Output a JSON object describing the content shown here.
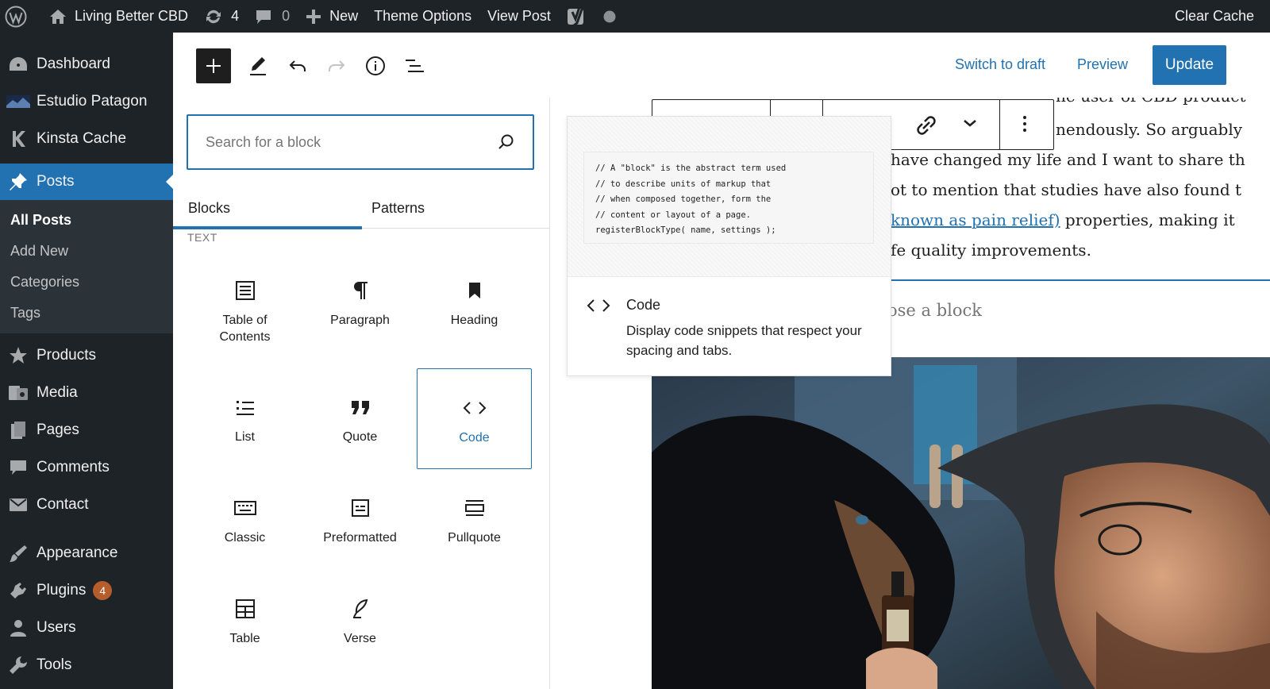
{
  "admin_bar": {
    "site_name": "Living Better CBD",
    "updates_count": "4",
    "comments_count": "0",
    "new_label": "New",
    "theme_options_label": "Theme Options",
    "view_post_label": "View Post",
    "clear_cache_label": "Clear Cache"
  },
  "sidebar": {
    "top_items": [
      {
        "label": "Dashboard",
        "icon": "dashboard-icon"
      },
      {
        "label": "Estudio Patagon",
        "icon": "estudio-logo-icon"
      },
      {
        "label": "Kinsta Cache",
        "icon": "kinsta-icon"
      }
    ],
    "posts_label": "Posts",
    "posts_submenu": [
      "All Posts",
      "Add New",
      "Categories",
      "Tags"
    ],
    "items": [
      {
        "label": "Products",
        "icon": "star-icon"
      },
      {
        "label": "Media",
        "icon": "media-icon"
      },
      {
        "label": "Pages",
        "icon": "pages-icon"
      },
      {
        "label": "Comments",
        "icon": "comment-icon"
      },
      {
        "label": "Contact",
        "icon": "mail-icon"
      },
      {
        "label": "Appearance",
        "icon": "brush-icon"
      },
      {
        "label": "Plugins",
        "icon": "plugin-icon",
        "badge": "4"
      },
      {
        "label": "Users",
        "icon": "user-icon"
      },
      {
        "label": "Tools",
        "icon": "wrench-icon"
      }
    ]
  },
  "header": {
    "switch_to_draft": "Switch to draft",
    "preview": "Preview",
    "update": "Update"
  },
  "inserter": {
    "search_placeholder": "Search for a block",
    "tabs": [
      "Blocks",
      "Patterns"
    ],
    "active_tab": "Blocks",
    "category": "TEXT",
    "blocks": [
      {
        "label": "Table of Contents",
        "icon": "table-of-contents-icon"
      },
      {
        "label": "Paragraph",
        "icon": "paragraph-icon"
      },
      {
        "label": "Heading",
        "icon": "heading-bookmark-icon"
      },
      {
        "label": "List",
        "icon": "list-icon"
      },
      {
        "label": "Quote",
        "icon": "quote-icon"
      },
      {
        "label": "Code",
        "icon": "code-icon",
        "selected": true
      },
      {
        "label": "Classic",
        "icon": "keyboard-icon"
      },
      {
        "label": "Preformatted",
        "icon": "preformatted-icon"
      },
      {
        "label": "Pullquote",
        "icon": "pullquote-icon"
      },
      {
        "label": "Table",
        "icon": "table-icon"
      },
      {
        "label": "Verse",
        "icon": "feather-icon"
      }
    ]
  },
  "preview": {
    "code_lines": [
      "// A \"block\" is the abstract term used",
      "// to describe units of markup that",
      "// when composed together, form the",
      "// content or layout of a page.",
      "registerBlockType( name, settings );"
    ],
    "title": "Code",
    "description": "Display code snippets that respect your spacing and tabs."
  },
  "content": {
    "lines": [
      "ne user of CBD product",
      "nendously. So arguably",
      "have changed my life and I want to share th",
      "ot to mention that studies have also found t",
      "fe quality improvements."
    ],
    "link_text": "known as pain relief)",
    "link_line_rest": " properties, making it",
    "appender_text": "ose a block"
  },
  "colors": {
    "admin_dark": "#1d2327",
    "accent": "#2271b1",
    "text": "#1e1e1e"
  }
}
